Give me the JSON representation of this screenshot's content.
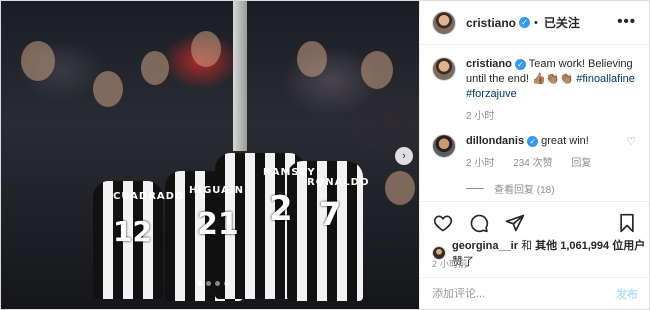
{
  "post": {
    "author": "cristiano",
    "follow_label": "已关注",
    "more_label": "•••",
    "caption": {
      "author": "cristiano",
      "text": "Team work! Believing until the end! 👍🏽👏🏽👏🏽 ",
      "hashtags": [
        "#finoallafine",
        "#forzajuve"
      ],
      "time": "2 小时"
    },
    "comments": [
      {
        "author": "dillondanis",
        "text": "great win!",
        "time": "2 小时",
        "likes": "234 次赞",
        "reply_label": "回复",
        "view_replies": "查看回复 (18)"
      }
    ],
    "likes_summary": {
      "user": "georgina__ir",
      "joiner": "和",
      "others_prefix": "其他",
      "count": "1,061,994",
      "suffix": "位用户",
      "liked": "赞了"
    },
    "timestamp": "2 小时前",
    "comment_placeholder": "添加评论...",
    "post_button": "发布"
  },
  "photo": {
    "jersey_names": [
      "CUADRADO",
      "HIGUAIN",
      "RAMSEY",
      "RONALDO"
    ],
    "jersey_numbers": [
      "12",
      "21",
      "2",
      "7"
    ],
    "carousel_dots": 4,
    "active_dot": 1
  },
  "icons": {
    "verified": "verified-badge-icon",
    "heart": "heart-icon",
    "comment": "comment-icon",
    "share": "share-icon",
    "bookmark": "bookmark-icon",
    "next": "chevron-right-icon"
  },
  "colors": {
    "verified": "#3897f0",
    "hashtag": "#003569",
    "muted": "#8e8e8e",
    "post_button_disabled": "#b2dffc"
  }
}
